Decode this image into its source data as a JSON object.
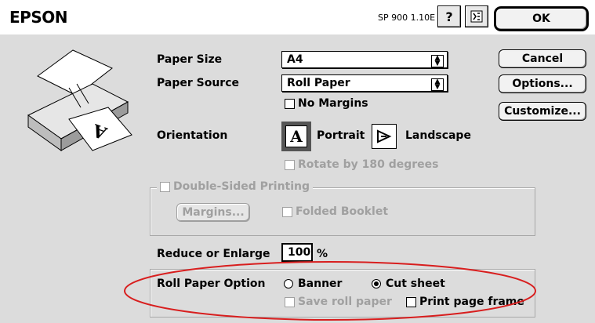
{
  "header": {
    "brand": "EPSON",
    "version": "SP 900 1.10E",
    "help_icon": "?"
  },
  "buttons": {
    "ok": "OK",
    "cancel": "Cancel",
    "options": "Options...",
    "customize": "Customize..."
  },
  "paper": {
    "size_label": "Paper Size",
    "size_value": "A4",
    "source_label": "Paper Source",
    "source_value": "Roll Paper",
    "no_margins_label": "No Margins"
  },
  "orientation": {
    "label": "Orientation",
    "portrait_label": "Portrait",
    "landscape_label": "Landscape",
    "rotate_label": "Rotate by 180 degrees",
    "selected": "portrait"
  },
  "double_sided": {
    "label": "Double-Sided Printing",
    "margins_button": "Margins...",
    "folded_booklet_label": "Folded Booklet"
  },
  "scale": {
    "label": "Reduce or Enlarge",
    "value": "100",
    "unit": "%"
  },
  "roll_paper": {
    "label": "Roll Paper Option",
    "banner_label": "Banner",
    "cut_sheet_label": "Cut sheet",
    "selected": "cut_sheet",
    "save_roll_label": "Save roll paper",
    "print_frame_label": "Print page frame"
  },
  "colors": {
    "panel": "#dcdcdc",
    "highlight_ellipse": "#d81e1e",
    "disabled_text": "#a0a0a0"
  }
}
